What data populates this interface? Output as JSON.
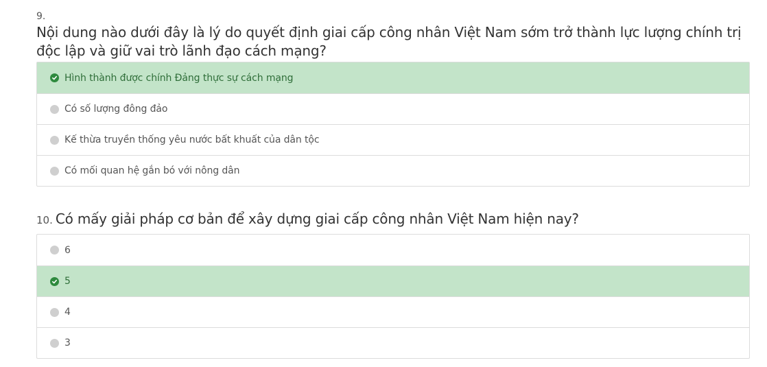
{
  "questions": [
    {
      "number": "9.",
      "title": "Nội dung nào dưới đây là lý do quyết định giai cấp công nhân Việt Nam sớm trở thành lực lượng chính trị độc lập và giữ vai trò lãnh đạo cách mạng?",
      "options": [
        {
          "label": "Hình thành được chính Đảng thực sự cách mạng",
          "correct": true
        },
        {
          "label": "Có số lượng đông đảo",
          "correct": false
        },
        {
          "label": "Kế thừa truyền thống yêu nước bất khuất của dân tộc",
          "correct": false
        },
        {
          "label": "Có mối quan hệ gắn bó với nông dân",
          "correct": false
        }
      ]
    },
    {
      "number": "10.",
      "title": "Có mấy giải pháp cơ bản để xây dựng giai cấp công nhân Việt Nam hiện nay?",
      "options": [
        {
          "label": "6",
          "correct": false
        },
        {
          "label": "5",
          "correct": true
        },
        {
          "label": "4",
          "correct": false
        },
        {
          "label": "3",
          "correct": false
        }
      ]
    }
  ],
  "colors": {
    "correct_background": "#c3e4c9",
    "correct_icon": "#2e8a3e",
    "border": "#dcdcdc",
    "bullet": "#cfcfcf"
  },
  "icons": {
    "correct": "check-circle-icon",
    "unselected": "radio-dot-icon"
  }
}
